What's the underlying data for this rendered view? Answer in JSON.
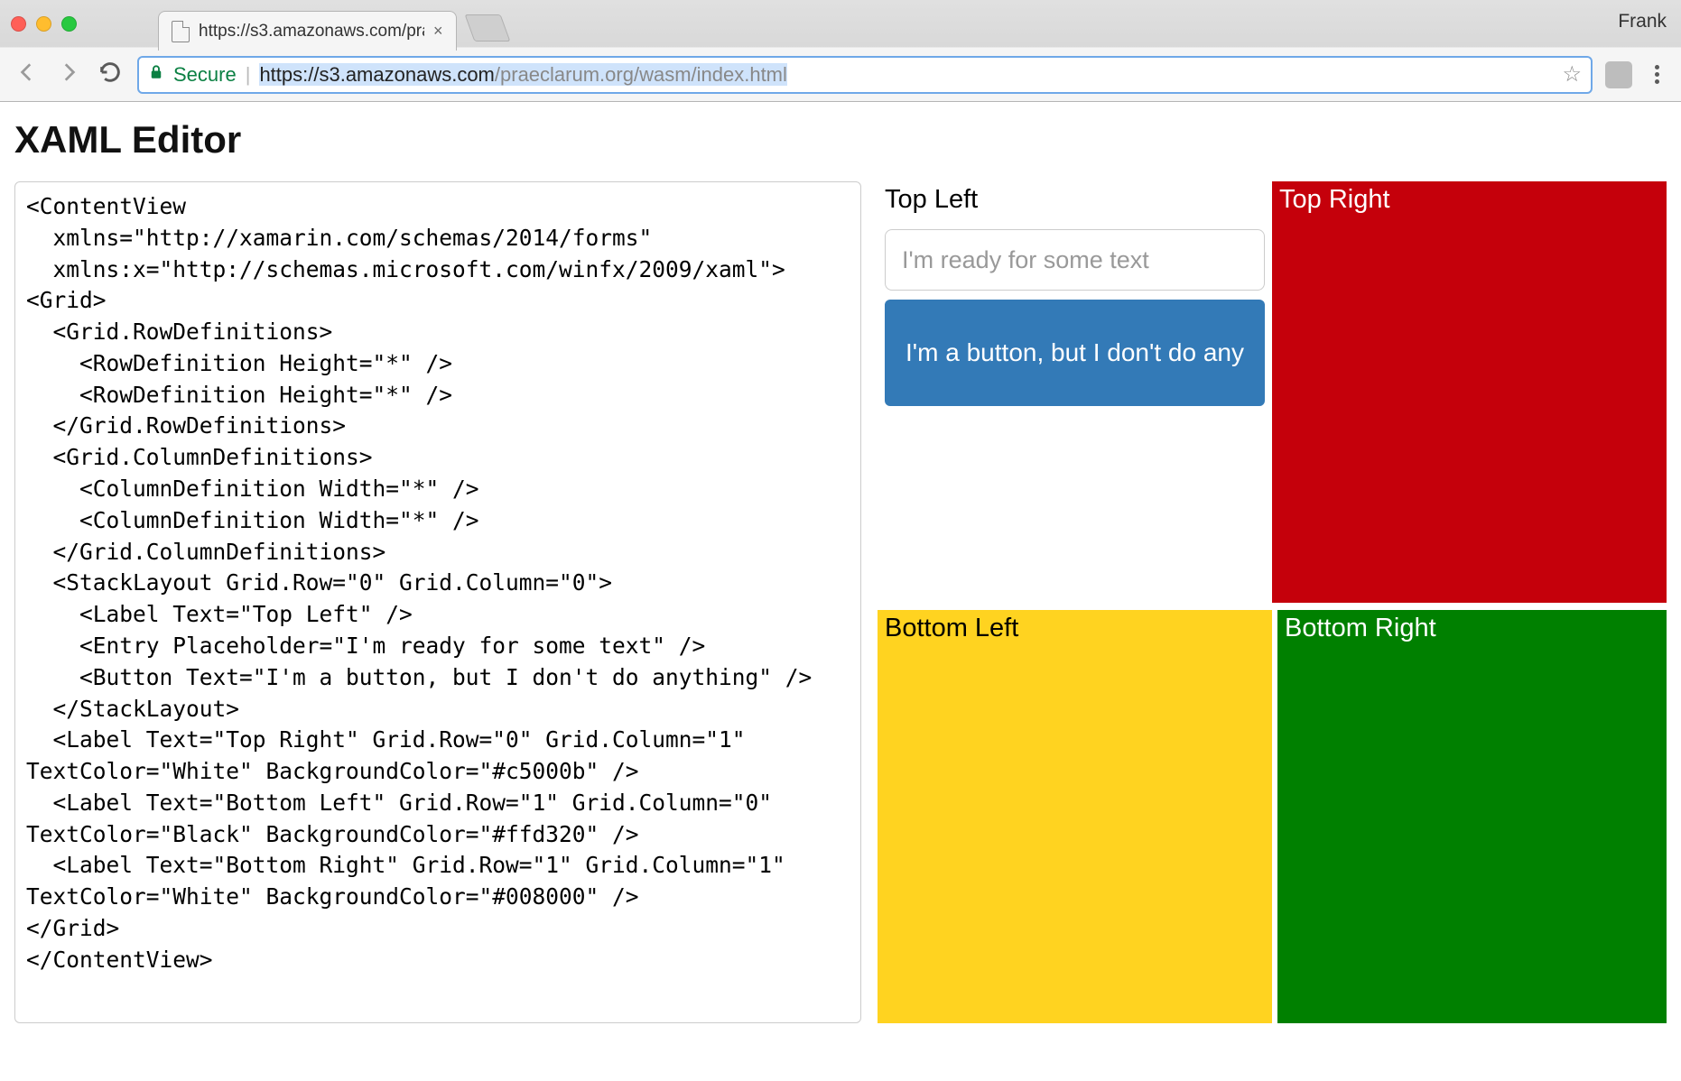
{
  "browser": {
    "profile": "Frank",
    "tab_title": "https://s3.amazonaws.com/pra",
    "secure_label": "Secure",
    "url_host": "https://s3.amazonaws.com",
    "url_path": "/praeclarum.org/wasm/index.html"
  },
  "page": {
    "title": "XAML Editor"
  },
  "code": "<ContentView\n  xmlns=\"http://xamarin.com/schemas/2014/forms\"\n  xmlns:x=\"http://schemas.microsoft.com/winfx/2009/xaml\">\n<Grid>\n  <Grid.RowDefinitions>\n    <RowDefinition Height=\"*\" />\n    <RowDefinition Height=\"*\" />\n  </Grid.RowDefinitions>\n  <Grid.ColumnDefinitions>\n    <ColumnDefinition Width=\"*\" />\n    <ColumnDefinition Width=\"*\" />\n  </Grid.ColumnDefinitions>\n  <StackLayout Grid.Row=\"0\" Grid.Column=\"0\">\n    <Label Text=\"Top Left\" />\n    <Entry Placeholder=\"I'm ready for some text\" />\n    <Button Text=\"I'm a button, but I don't do anything\" />\n  </StackLayout>\n  <Label Text=\"Top Right\" Grid.Row=\"0\" Grid.Column=\"1\"\nTextColor=\"White\" BackgroundColor=\"#c5000b\" />\n  <Label Text=\"Bottom Left\" Grid.Row=\"1\" Grid.Column=\"0\"\nTextColor=\"Black\" BackgroundColor=\"#ffd320\" />\n  <Label Text=\"Bottom Right\" Grid.Row=\"1\" Grid.Column=\"1\"\nTextColor=\"White\" BackgroundColor=\"#008000\" />\n</Grid>\n</ContentView>",
  "preview": {
    "top_left": {
      "label": "Top Left",
      "entry_placeholder": "I'm ready for some text",
      "button_text": "I'm a button, but I don't do any"
    },
    "top_right": {
      "label": "Top Right",
      "bg": "#c5000b",
      "fg": "#ffffff"
    },
    "bottom_left": {
      "label": "Bottom Left",
      "bg": "#ffd320",
      "fg": "#000000"
    },
    "bottom_right": {
      "label": "Bottom Right",
      "bg": "#008000",
      "fg": "#ffffff"
    }
  }
}
